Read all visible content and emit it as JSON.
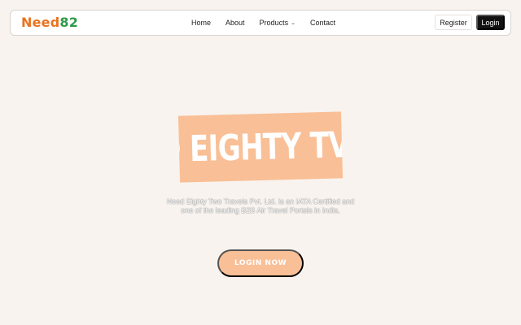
{
  "brand": {
    "name_part1": "Need",
    "name_part2": "82"
  },
  "nav": {
    "items": [
      {
        "label": "Home"
      },
      {
        "label": "About"
      },
      {
        "label": "Products",
        "dropdown": true
      },
      {
        "label": "Contact"
      }
    ],
    "register_label": "Register",
    "login_label": "Login"
  },
  "hero": {
    "banner_text": "ED EIGHTY TV",
    "description": "Need Eighty Two Travels Pvt. Ltd. is an IATA Certified and one of the leading B2B Air Travel Portals in India.",
    "cta_label": "LOGIN NOW"
  },
  "colors": {
    "brand_orange": "#e8731f",
    "brand_green": "#2e9a4b",
    "accent_peach": "#f9bf96",
    "background": "#f8f3ef",
    "login_button": "#121212"
  },
  "icons": {
    "products_dropdown": "chevron-down-icon"
  }
}
